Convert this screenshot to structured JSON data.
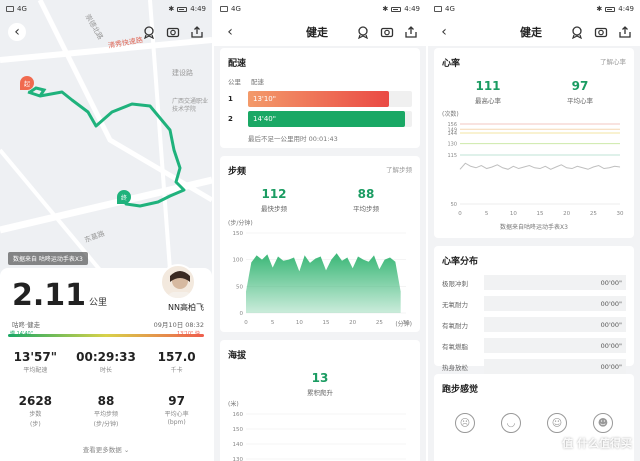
{
  "status_bar": {
    "signal": "4G",
    "time": "4:49"
  },
  "panel1": {
    "map": {
      "streets": [
        "崇德北路",
        "清秀快速路",
        "建设路",
        "东葛路"
      ],
      "poi": "广西交通职业技术学院",
      "start_marker": "起",
      "end_marker": "终"
    },
    "data_source": "数据来自 咕咚运动手表X3",
    "avatar_name": "NN高柏飞",
    "distance": "2.11",
    "distance_unit": "公里",
    "type_label": "咕咚·健走",
    "datetime": "09月10日 08:32",
    "pace_left": "慢 14'40\"",
    "pace_right": "13'10\" 快",
    "row1": [
      {
        "value": "13'57\"",
        "label": "平均配速"
      },
      {
        "value": "00:29:33",
        "label": "时长"
      },
      {
        "value": "157.0",
        "label": "千卡"
      }
    ],
    "row2": [
      {
        "value": "2628",
        "label": "步数",
        "unit": "(步)"
      },
      {
        "value": "88",
        "label": "平均步频",
        "unit": "(步/分钟)"
      },
      {
        "value": "97",
        "label": "平均心率",
        "unit": "(bpm)"
      }
    ],
    "more": "查看更多数据"
  },
  "panel2": {
    "title": "健走",
    "pace": {
      "heading": "配速",
      "col_km": "公里",
      "col_pace": "配速",
      "rows": [
        {
          "km": "1",
          "pace": "13'10\"",
          "fraction": 0.86,
          "color": "#ef5d4c"
        },
        {
          "km": "2",
          "pace": "14'40\"",
          "fraction": 0.96,
          "color": "#1aa865"
        }
      ],
      "note": "最后不足一公里用时 00:01:43"
    },
    "cadence": {
      "heading": "步频",
      "link": "了解步频",
      "max_value": "112",
      "max_label": "最快步频",
      "avg_value": "88",
      "avg_label": "平均步频",
      "y_unit": "(步/分钟)",
      "x_unit": "(分钟)"
    },
    "elevation": {
      "heading": "海拔",
      "value": "13",
      "label": "累积爬升",
      "y_unit": "(米)"
    }
  },
  "panel3": {
    "title": "健走",
    "hr": {
      "heading": "心率",
      "link": "了解心率",
      "max_value": "111",
      "max_label": "最高心率",
      "avg_value": "97",
      "avg_label": "平均心率",
      "y_unit": "(次数)",
      "x_unit": "分钟",
      "source": "数据来自咕咚运动手表X3"
    },
    "zones": {
      "heading": "心率分布",
      "rows": [
        {
          "name": "极限冲刺",
          "time": "00'00\""
        },
        {
          "name": "无氧耐力",
          "time": "00'00\""
        },
        {
          "name": "有氧耐力",
          "time": "00'00\""
        },
        {
          "name": "有氧燃脂",
          "time": "00'00\""
        },
        {
          "name": "热身放松",
          "time": "00'00\""
        }
      ]
    },
    "feel": {
      "heading": "跑步感觉"
    },
    "watermark": "值 什么值得买"
  },
  "chart_data": [
    {
      "type": "area",
      "title": "步频",
      "ylabel": "(步/分钟)",
      "xlabel": "(分钟)",
      "ylim": [
        0,
        150
      ],
      "y_ticks": [
        0,
        50,
        100,
        150
      ],
      "x_ticks": [
        0,
        5,
        10,
        15,
        20,
        25,
        30
      ],
      "x": [
        0,
        1,
        2,
        3,
        4,
        5,
        6,
        7,
        8,
        9,
        10,
        11,
        12,
        13,
        14,
        15,
        16,
        17,
        18,
        19,
        20,
        21,
        22,
        23,
        24,
        25,
        26,
        27,
        28,
        29
      ],
      "values": [
        40,
        95,
        108,
        100,
        110,
        85,
        106,
        98,
        100,
        104,
        78,
        108,
        94,
        102,
        106,
        80,
        100,
        112,
        98,
        104,
        84,
        106,
        100,
        96,
        108,
        82,
        100,
        104,
        96,
        40
      ],
      "color": "#2fb36f"
    },
    {
      "type": "area",
      "title": "海拔",
      "ylabel": "(米)",
      "ylim": [
        120,
        160
      ],
      "y_ticks": [
        120,
        130,
        140,
        150,
        160
      ],
      "x": [
        0,
        2,
        4,
        6,
        8,
        10,
        12,
        14,
        16,
        18,
        20,
        22,
        24,
        26,
        28,
        30
      ],
      "values": [
        124,
        125,
        126,
        125,
        124,
        126,
        128,
        127,
        126,
        125,
        126,
        125,
        124,
        125,
        124,
        124
      ],
      "color": "#2fb36f"
    },
    {
      "type": "line",
      "title": "心率",
      "ylabel": "(次数)",
      "xlabel": "分钟",
      "ylim": [
        50,
        156
      ],
      "y_ticks": [
        50,
        115,
        130,
        144,
        149,
        156
      ],
      "x_ticks": [
        0,
        5,
        10,
        15,
        20,
        25,
        30
      ],
      "x": [
        0,
        1,
        2,
        3,
        4,
        5,
        6,
        7,
        8,
        9,
        10,
        11,
        12,
        13,
        14,
        15,
        16,
        17,
        18,
        19,
        20,
        21,
        22,
        23,
        24,
        25,
        26,
        27,
        28,
        29,
        30
      ],
      "values": [
        96,
        104,
        100,
        98,
        101,
        97,
        99,
        102,
        98,
        96,
        100,
        97,
        99,
        101,
        98,
        97,
        100,
        96,
        99,
        102,
        98,
        97,
        100,
        98,
        96,
        99,
        101,
        97,
        98,
        100,
        99
      ],
      "color": "#bfbfbf",
      "threshold_lines": [
        {
          "value": 156,
          "color": "#f3c7c2"
        },
        {
          "value": 149,
          "color": "#f6d7b3"
        },
        {
          "value": 144,
          "color": "#f3e6a3"
        },
        {
          "value": 130,
          "color": "#cde9a9"
        },
        {
          "value": 115,
          "color": "#bfe3d4"
        }
      ]
    }
  ]
}
